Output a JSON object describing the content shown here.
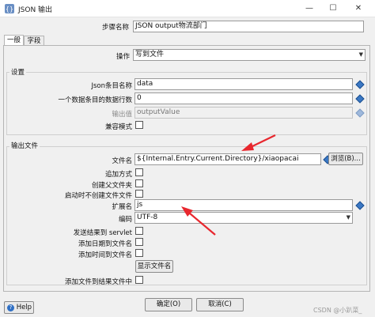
{
  "window": {
    "title": "JSON 输出",
    "minimize": "—",
    "maximize": "☐",
    "close": "✕",
    "app_icon": "json-step-icon"
  },
  "step": {
    "label": "步骤名称",
    "value": "JSON output物流部门"
  },
  "tabs": [
    {
      "label": "一般"
    },
    {
      "label": "字段"
    }
  ],
  "operation": {
    "label": "操作",
    "value": "写到文件"
  },
  "settings": {
    "title": "设置",
    "json_entry_name": {
      "label": "Json条目名称",
      "value": "data"
    },
    "rows_per_block": {
      "label": "一个数据条目的数据行数",
      "value": "0"
    },
    "output_value": {
      "label": "输出值",
      "placeholder": "outputValue"
    },
    "compat_mode": {
      "label": "兼容模式"
    }
  },
  "output_file": {
    "title": "输出文件",
    "filename": {
      "label": "文件名",
      "value": "${Internal.Entry.Current.Directory}/xiaopacai"
    },
    "browse_button": "浏览(B)...",
    "append": {
      "label": "追加方式"
    },
    "create_parent": {
      "label": "创建父文件夹"
    },
    "no_create_on_start": {
      "label": "启动时不创建文件文件"
    },
    "extension": {
      "label": "扩展名",
      "value": "js"
    },
    "encoding": {
      "label": "编码",
      "value": "UTF-8"
    },
    "send_to_servlet": {
      "label": "发送结果到 servlet"
    },
    "add_date": {
      "label": "添加日期到文件名"
    },
    "add_time": {
      "label": "添加时间到文件名"
    },
    "show_filename_button": "显示文件名",
    "add_to_result": {
      "label": "添加文件到结果文件中"
    }
  },
  "footer": {
    "help": "Help",
    "ok": "确定(O)",
    "cancel": "取消(C)",
    "watermark": "CSDN @小趴菜_"
  },
  "colors": {
    "annotation_arrow": "#e8272e",
    "variable_icon": "#3b78c4"
  }
}
